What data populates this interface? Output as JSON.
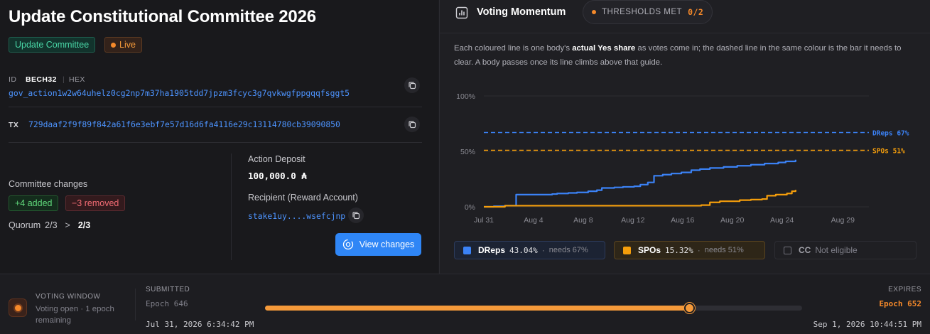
{
  "left": {
    "title": "Update Constitutional Committee 2026",
    "type_badge": "Update Committee",
    "status_badge": "Live",
    "id_label": "ID",
    "format_bech32": "BECH32",
    "format_sep": "|",
    "format_hex": "HEX",
    "gov_action_id": "gov_action1w2w64uhelz0cg2np7m37ha1905tdd7jpzm3fcyc3g7qvkwgfppgqqfsggt5",
    "tx_label": "TX",
    "tx_hash": "729daaf2f9f89f842a61f6e3ebf7e57d16d6fa4116e29c13114780cb39090850",
    "committee_changes_label": "Committee changes",
    "added": "+4 added",
    "removed": "−3 removed",
    "quorum_label": "Quorum",
    "quorum_old": "2/3",
    "quorum_arrow": ">",
    "quorum_new": "2/3",
    "deposit_label": "Action Deposit",
    "deposit_value": "100,000.0 ₳",
    "recipient_label": "Recipient (Reward Account)",
    "recipient_value": "stake1uy....wsefcjnp",
    "view_button": "View changes"
  },
  "right": {
    "title": "Voting Momentum",
    "thresholds_label": "THRESHOLDS MET",
    "thresholds_count": "0/2",
    "desc_1": "Each coloured line is one body's ",
    "desc_bold": "actual Yes share",
    "desc_2": " as votes come in; the dashed line in the same colour is the bar it needs to clear. A body passes once its line climbs above that guide.",
    "legend": {
      "dreps_name": "DReps",
      "dreps_pct": "43.04%",
      "dreps_need": "needs 67%",
      "spos_name": "SPOs",
      "spos_pct": "15.32%",
      "spos_need": "needs 51%",
      "dot": "·",
      "cc_name": "CC",
      "cc_status": "Not eligible"
    }
  },
  "chart_data": {
    "type": "line",
    "x_ticks": [
      "Jul 31",
      "Aug 4",
      "Aug 8",
      "Aug 12",
      "Aug 16",
      "Aug 20",
      "Aug 24",
      "Aug 29"
    ],
    "x_tick_days": [
      0,
      4,
      8,
      12,
      16,
      20,
      24,
      28.9
    ],
    "y_ticks": [
      "0%",
      "50%",
      "100%"
    ],
    "y_tick_values": [
      0,
      50,
      100
    ],
    "xlim": [
      0,
      31
    ],
    "ylim": [
      0,
      100
    ],
    "thresholds": [
      {
        "label": "DReps 67%",
        "value": 67,
        "color": "#3b82f6"
      },
      {
        "label": "SPOs 51%",
        "value": 51,
        "color": "#f59e0b"
      }
    ],
    "series": [
      {
        "name": "DReps",
        "color": "#3b82f6",
        "x": [
          0,
          0.8,
          1.7,
          2.4,
          2.6,
          3.5,
          4.5,
          5.5,
          5.9,
          6.8,
          7.5,
          8.4,
          9.1,
          9.5,
          10.5,
          11.2,
          12.1,
          12.6,
          13.2,
          13.7,
          14.4,
          15.1,
          15.9,
          16.7,
          17.4,
          18.2,
          19.3,
          20.4,
          21.5,
          22.6,
          23.7,
          24.3,
          25.1
        ],
        "y": [
          0,
          0.5,
          1,
          1,
          11,
          11,
          11,
          11.5,
          12,
          12.5,
          13,
          14,
          15,
          17,
          17.5,
          18,
          18.5,
          20,
          22,
          28,
          29,
          30,
          31,
          33,
          34,
          35,
          36,
          37,
          38,
          39,
          40,
          41,
          42.5
        ]
      },
      {
        "name": "SPOs",
        "color": "#f59e0b",
        "x": [
          0,
          1.7,
          4,
          8,
          12,
          16,
          17.5,
          18.2,
          19,
          20.6,
          21.5,
          22.4,
          22.8,
          23.5,
          24.4,
          24.8,
          25.1
        ],
        "y": [
          0,
          1,
          1,
          1,
          1,
          1,
          1.5,
          4,
          5,
          6,
          6.5,
          7,
          10,
          11,
          12,
          14,
          15.3
        ]
      }
    ]
  },
  "bottom": {
    "vw_label": "VOTING WINDOW",
    "vw_status": "Voting open · 1 epoch remaining",
    "submitted_label": "SUBMITTED",
    "submitted_epoch": "Epoch 646",
    "submitted_date": "Jul 31, 2026 6:34:42 PM",
    "expires_label": "EXPIRES",
    "expires_epoch": "Epoch 652",
    "expires_date": "Sep 1, 2026 10:44:51 PM",
    "progress": 0.79
  }
}
